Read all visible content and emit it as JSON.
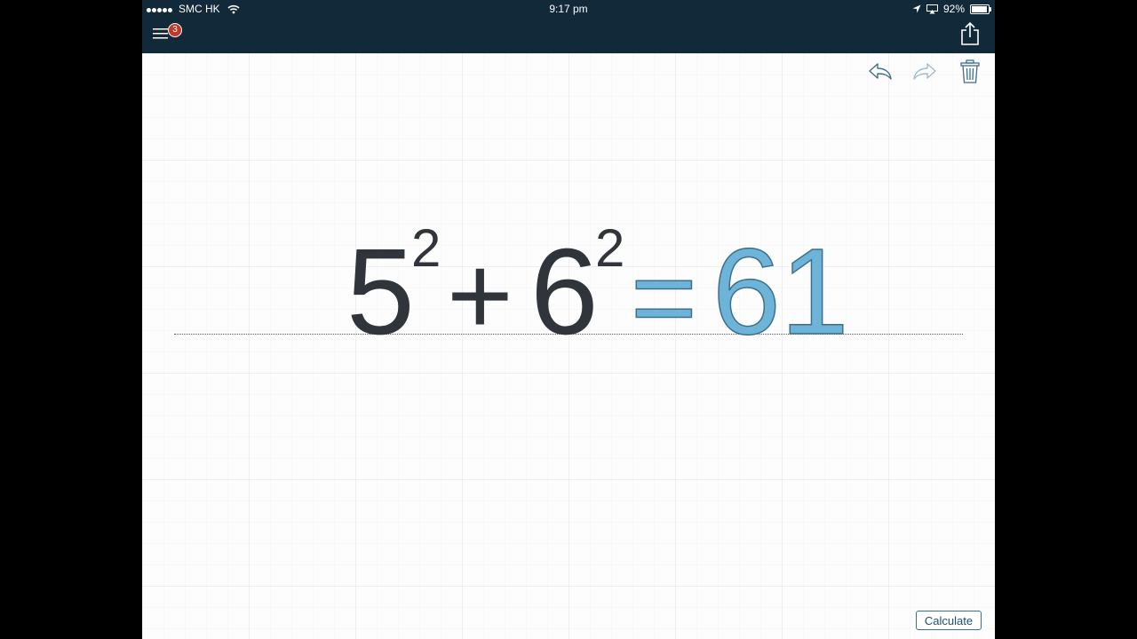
{
  "status_bar": {
    "carrier": "SMC HK",
    "time": "9:17 pm",
    "battery": "92%",
    "battery_level": 0.92,
    "signal_icon": "signal-dots-icon",
    "wifi_icon": "wifi-icon",
    "location_icon": "location-arrow-icon",
    "airplay_icon": "airplay-icon"
  },
  "toolbar": {
    "menu_icon": "hamburger-menu-icon",
    "notification_count": "3",
    "share_icon": "share-icon",
    "undo_icon": "undo-icon",
    "redo_icon": "redo-icon",
    "trash_icon": "trash-icon"
  },
  "equation": {
    "term1_base": "5",
    "term1_exponent": "2",
    "operator": "+",
    "term2_base": "6",
    "term2_exponent": "2",
    "equals": "=",
    "result": "61"
  },
  "calculate_label": "Calculate",
  "colors": {
    "topbar": "#12293a",
    "ink": "#2f353b",
    "result": "#6eb4d8",
    "accent": "#3c6e8e",
    "badge": "#c0392b"
  }
}
